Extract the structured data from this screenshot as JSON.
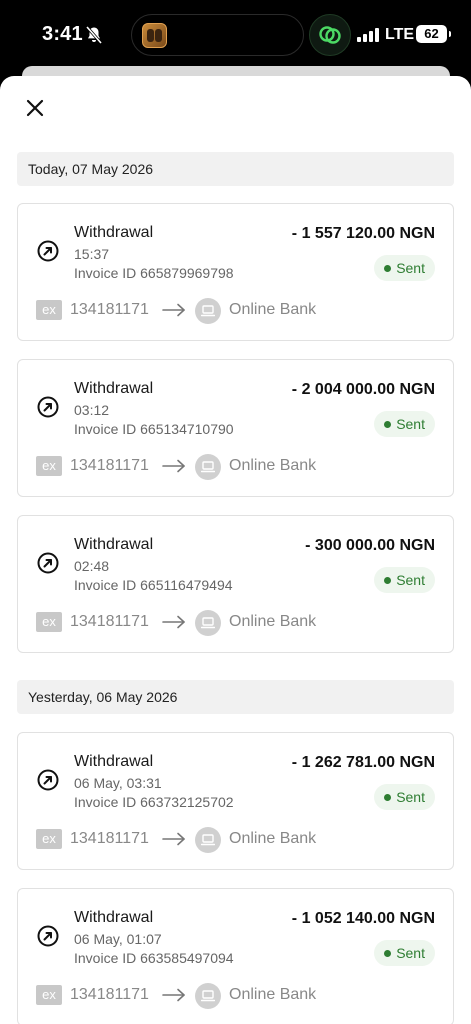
{
  "status_bar": {
    "time": "3:41",
    "network": "LTE",
    "battery": "62"
  },
  "groups": [
    {
      "date": "Today, 07 May 2026",
      "items": [
        {
          "type": "Withdrawal",
          "time": "15:37",
          "invoice": "Invoice ID 665879969798",
          "amount": "- 1 557 120.00 NGN",
          "status": "Sent",
          "from_logo": "ex",
          "from": "134181171",
          "to": "Online Bank"
        },
        {
          "type": "Withdrawal",
          "time": "03:12",
          "invoice": "Invoice ID 665134710790",
          "amount": "- 2 004 000.00 NGN",
          "status": "Sent",
          "from_logo": "ex",
          "from": "134181171",
          "to": "Online Bank"
        },
        {
          "type": "Withdrawal",
          "time": "02:48",
          "invoice": "Invoice ID 665116479494",
          "amount": "- 300 000.00 NGN",
          "status": "Sent",
          "from_logo": "ex",
          "from": "134181171",
          "to": "Online Bank"
        }
      ]
    },
    {
      "date": "Yesterday, 06 May 2026",
      "items": [
        {
          "type": "Withdrawal",
          "time": "06 May, 03:31",
          "invoice": "Invoice ID 663732125702",
          "amount": "- 1 262 781.00 NGN",
          "status": "Sent",
          "from_logo": "ex",
          "from": "134181171",
          "to": "Online Bank"
        },
        {
          "type": "Withdrawal",
          "time": "06 May, 01:07",
          "invoice": "Invoice ID 663585497094",
          "amount": "- 1 052 140.00 NGN",
          "status": "Sent",
          "from_logo": "ex",
          "from": "134181171",
          "to": "Online Bank"
        }
      ]
    }
  ],
  "colors": {
    "status_sent": "#2e7d32",
    "badge_bg": "#eef6ee",
    "header_bg": "#f1f1f1"
  }
}
